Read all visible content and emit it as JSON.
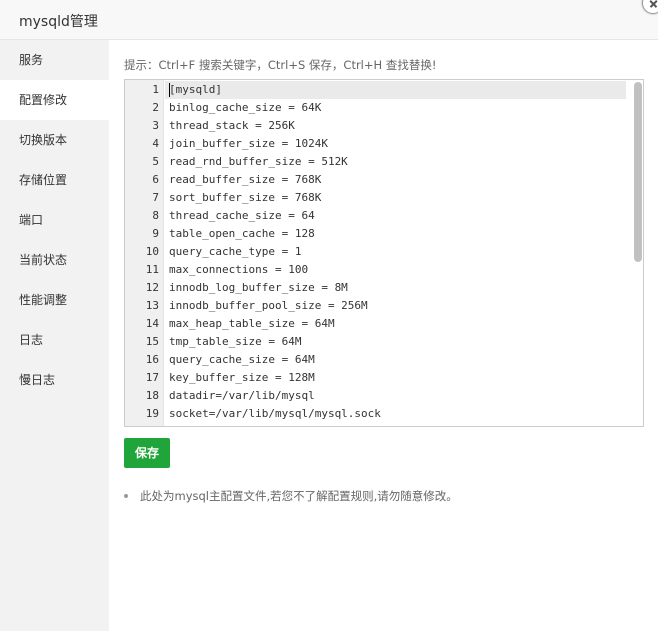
{
  "window": {
    "title": "mysqld管理"
  },
  "sidebar": {
    "items": [
      {
        "label": "服务",
        "active": false
      },
      {
        "label": "配置修改",
        "active": true
      },
      {
        "label": "切换版本",
        "active": false
      },
      {
        "label": "存储位置",
        "active": false
      },
      {
        "label": "端口",
        "active": false
      },
      {
        "label": "当前状态",
        "active": false
      },
      {
        "label": "性能调整",
        "active": false
      },
      {
        "label": "日志",
        "active": false
      },
      {
        "label": "慢日志",
        "active": false
      }
    ]
  },
  "main": {
    "tip": "提示：Ctrl+F 搜索关键字，Ctrl+S 保存，Ctrl+H 查找替换!",
    "editor": {
      "lines": [
        {
          "n": "1",
          "text": "[mysqld]"
        },
        {
          "n": "2",
          "text": "binlog_cache_size = 64K"
        },
        {
          "n": "3",
          "text": "thread_stack = 256K"
        },
        {
          "n": "4",
          "text": "join_buffer_size = 1024K"
        },
        {
          "n": "5",
          "text": "read_rnd_buffer_size = 512K"
        },
        {
          "n": "6",
          "text": "read_buffer_size = 768K"
        },
        {
          "n": "7",
          "text": "sort_buffer_size = 768K"
        },
        {
          "n": "8",
          "text": "thread_cache_size = 64"
        },
        {
          "n": "9",
          "text": "table_open_cache = 128"
        },
        {
          "n": "10",
          "text": "query_cache_type = 1"
        },
        {
          "n": "11",
          "text": "max_connections = 100"
        },
        {
          "n": "12",
          "text": "innodb_log_buffer_size = 8M"
        },
        {
          "n": "13",
          "text": "innodb_buffer_pool_size = 256M"
        },
        {
          "n": "14",
          "text": "max_heap_table_size = 64M"
        },
        {
          "n": "15",
          "text": "tmp_table_size = 64M"
        },
        {
          "n": "16",
          "text": "query_cache_size = 64M"
        },
        {
          "n": "17",
          "text": "key_buffer_size = 128M"
        },
        {
          "n": "18",
          "text": "datadir=/var/lib/mysql"
        },
        {
          "n": "19",
          "text": "socket=/var/lib/mysql/mysql.sock"
        }
      ]
    },
    "save_label": "保存",
    "notes": [
      "此处为mysql主配置文件,若您不了解配置规则,请勿随意修改。"
    ]
  }
}
